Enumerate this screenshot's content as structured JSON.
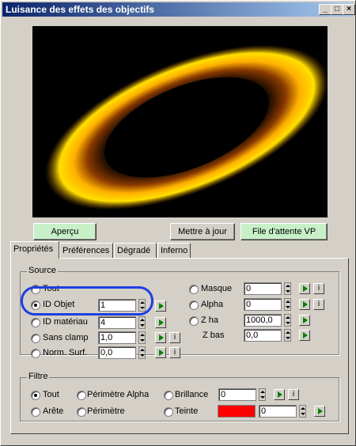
{
  "window": {
    "title": "Luisance des effets des objectifs",
    "minimize": "_",
    "maximize": "□",
    "close": "×"
  },
  "buttons": {
    "preview": "Aperçu",
    "update": "Mettre à jour",
    "vp_queue": "File d'attente VP"
  },
  "tabs": [
    "Propriétés",
    "Préférences",
    "Dégradé",
    "Inferno"
  ],
  "source": {
    "title": "Source",
    "left": [
      {
        "label": "Tout",
        "value": null
      },
      {
        "label": "ID Objet",
        "value": "1"
      },
      {
        "label": "ID matériau",
        "value": "4"
      },
      {
        "label": "Sans clamp",
        "value": "1,0"
      },
      {
        "label": "Norm. Surf.",
        "value": "0,0"
      }
    ],
    "right": [
      {
        "label": "Masque",
        "value": "0"
      },
      {
        "label": "Alpha",
        "value": "0"
      },
      {
        "label": "Z ha",
        "value": "1000,0"
      },
      {
        "label": "Z bas",
        "value": "0,0"
      }
    ],
    "selected": "ID Objet",
    "info_button": "i"
  },
  "filter": {
    "title": "Filtre",
    "options": [
      "Tout",
      "Arête",
      "Périmètre Alpha",
      "Périmètre",
      "Brillance",
      "Teinte"
    ],
    "selected": "Tout",
    "brightness": "0",
    "tint_value": "0",
    "tint_color": "#ff0000"
  },
  "colors": {
    "title_start": "#0a246a",
    "green_button": "#c8f0c8",
    "highlight": "#1e3ee0"
  }
}
